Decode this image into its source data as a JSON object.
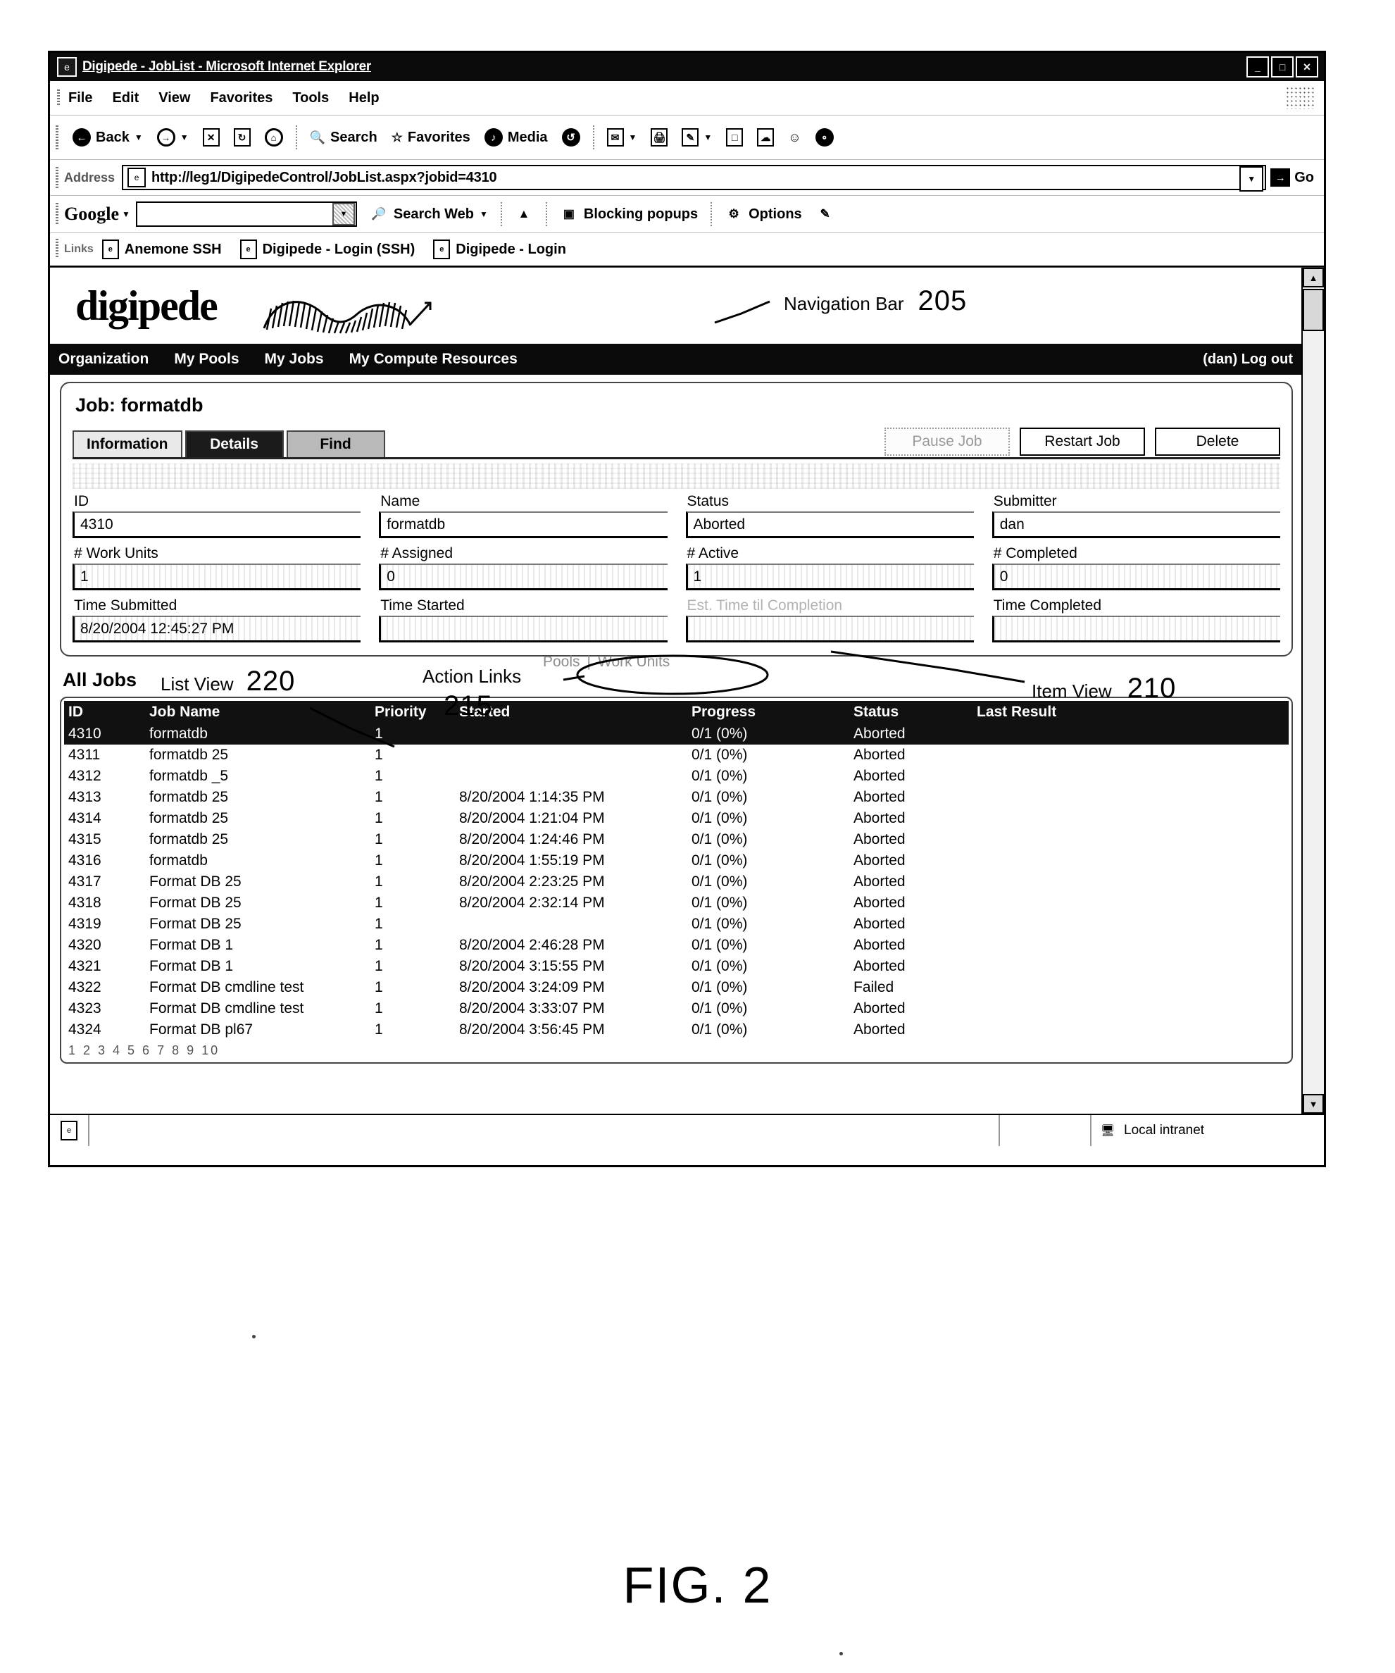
{
  "window": {
    "title": "Digipede - JobList - Microsoft Internet Explorer",
    "minimize": "_",
    "maximize": "□",
    "close": "✕"
  },
  "menu": {
    "items": [
      "File",
      "Edit",
      "View",
      "Favorites",
      "Tools",
      "Help"
    ]
  },
  "toolbar": {
    "back": "Back",
    "search": "Search",
    "favorites": "Favorites",
    "media": "Media"
  },
  "address": {
    "label": "Address",
    "url": "http://leg1/DigipedeControl/JobList.aspx?jobid=4310",
    "go": "Go"
  },
  "google_bar": {
    "logo": "Google",
    "search_value": "",
    "search_web": "Search Web",
    "blocking": "Blocking popups",
    "options": "Options"
  },
  "links_bar": {
    "label": "Links",
    "items": [
      "Anemone SSH",
      "Digipede - Login (SSH)",
      "Digipede - Login"
    ]
  },
  "brand": {
    "name": "digipede"
  },
  "nav": {
    "items": [
      "Organization",
      "My Pools",
      "My Jobs",
      "My Compute Resources"
    ],
    "user": "(dan) Log out"
  },
  "job_panel": {
    "title": "Job: formatdb",
    "tabs": [
      {
        "label": "Information",
        "state": "light"
      },
      {
        "label": "Details",
        "state": "dark"
      },
      {
        "label": "Find",
        "state": "mid"
      }
    ],
    "actions": [
      {
        "label": "Pause Job",
        "enabled": false
      },
      {
        "label": "Restart Job",
        "enabled": true
      },
      {
        "label": "Delete",
        "enabled": true
      }
    ],
    "fields": [
      {
        "label": "ID",
        "value": "4310",
        "dim": false
      },
      {
        "label": "Name",
        "value": "formatdb",
        "dim": false
      },
      {
        "label": "Status",
        "value": "Aborted",
        "dim": false
      },
      {
        "label": "Submitter",
        "value": "dan",
        "dim": false
      },
      {
        "label": "# Work Units",
        "value": "1",
        "dim": false
      },
      {
        "label": "# Assigned",
        "value": "0",
        "dim": false
      },
      {
        "label": "# Active",
        "value": "1",
        "dim": false
      },
      {
        "label": "# Completed",
        "value": "0",
        "dim": false
      },
      {
        "label": "Time Submitted",
        "value": "8/20/2004 12:45:27 PM",
        "dim": false
      },
      {
        "label": "Time Started",
        "value": "",
        "dim": false
      },
      {
        "label": "Est. Time til Completion",
        "value": "",
        "dim": true
      },
      {
        "label": "Time Completed",
        "value": "",
        "dim": false
      }
    ]
  },
  "action_links": {
    "pools": "Pools",
    "separator": "|",
    "work_units": "Work Units"
  },
  "annotations": [
    {
      "label": "Navigation Bar",
      "number": "205"
    },
    {
      "label": "Item View",
      "number": "210"
    },
    {
      "label": "Action Links",
      "number": "215"
    },
    {
      "label": "List View",
      "number": "220"
    }
  ],
  "list_view": {
    "heading": "All Jobs",
    "columns": [
      "ID",
      "Job Name",
      "Priority",
      "Started",
      "Progress",
      "Status",
      "Last Result"
    ],
    "rows": [
      {
        "id": "4310",
        "name": "formatdb",
        "priority": "1",
        "started": "",
        "progress": "0/1 (0%)",
        "status": "Aborted",
        "last_result": "",
        "selected": true
      },
      {
        "id": "4311",
        "name": "formatdb 25",
        "priority": "1",
        "started": "",
        "progress": "0/1 (0%)",
        "status": "Aborted",
        "last_result": "",
        "selected": false
      },
      {
        "id": "4312",
        "name": "formatdb _5",
        "priority": "1",
        "started": "",
        "progress": "0/1 (0%)",
        "status": "Aborted",
        "last_result": "",
        "selected": false
      },
      {
        "id": "4313",
        "name": "formatdb 25",
        "priority": "1",
        "started": "8/20/2004 1:14:35 PM",
        "progress": "0/1 (0%)",
        "status": "Aborted",
        "last_result": "",
        "selected": false
      },
      {
        "id": "4314",
        "name": "formatdb 25",
        "priority": "1",
        "started": "8/20/2004 1:21:04 PM",
        "progress": "0/1 (0%)",
        "status": "Aborted",
        "last_result": "",
        "selected": false
      },
      {
        "id": "4315",
        "name": "formatdb 25",
        "priority": "1",
        "started": "8/20/2004 1:24:46 PM",
        "progress": "0/1 (0%)",
        "status": "Aborted",
        "last_result": "",
        "selected": false
      },
      {
        "id": "4316",
        "name": "formatdb",
        "priority": "1",
        "started": "8/20/2004 1:55:19 PM",
        "progress": "0/1 (0%)",
        "status": "Aborted",
        "last_result": "",
        "selected": false
      },
      {
        "id": "4317",
        "name": "Format DB 25",
        "priority": "1",
        "started": "8/20/2004 2:23:25 PM",
        "progress": "0/1 (0%)",
        "status": "Aborted",
        "last_result": "",
        "selected": false
      },
      {
        "id": "4318",
        "name": "Format DB 25",
        "priority": "1",
        "started": "8/20/2004 2:32:14 PM",
        "progress": "0/1 (0%)",
        "status": "Aborted",
        "last_result": "",
        "selected": false
      },
      {
        "id": "4319",
        "name": "Format DB 25",
        "priority": "1",
        "started": "",
        "progress": "0/1 (0%)",
        "status": "Aborted",
        "last_result": "",
        "selected": false
      },
      {
        "id": "4320",
        "name": "Format DB 1",
        "priority": "1",
        "started": "8/20/2004 2:46:28 PM",
        "progress": "0/1 (0%)",
        "status": "Aborted",
        "last_result": "",
        "selected": false
      },
      {
        "id": "4321",
        "name": "Format DB 1",
        "priority": "1",
        "started": "8/20/2004 3:15:55 PM",
        "progress": "0/1 (0%)",
        "status": "Aborted",
        "last_result": "",
        "selected": false
      },
      {
        "id": "4322",
        "name": "Format DB cmdline test",
        "priority": "1",
        "started": "8/20/2004 3:24:09 PM",
        "progress": "0/1 (0%)",
        "status": "Failed",
        "last_result": "",
        "selected": false
      },
      {
        "id": "4323",
        "name": "Format DB cmdline test",
        "priority": "1",
        "started": "8/20/2004 3:33:07 PM",
        "progress": "0/1 (0%)",
        "status": "Aborted",
        "last_result": "",
        "selected": false
      },
      {
        "id": "4324",
        "name": "Format DB pl67",
        "priority": "1",
        "started": "8/20/2004 3:56:45 PM",
        "progress": "0/1 (0%)",
        "status": "Aborted",
        "last_result": "",
        "selected": false
      }
    ],
    "pager": "1 2 3 4 5 6 7 8 9 10"
  },
  "status_bar": {
    "zone": "Local intranet"
  },
  "figure": {
    "caption": "FIG. 2"
  }
}
